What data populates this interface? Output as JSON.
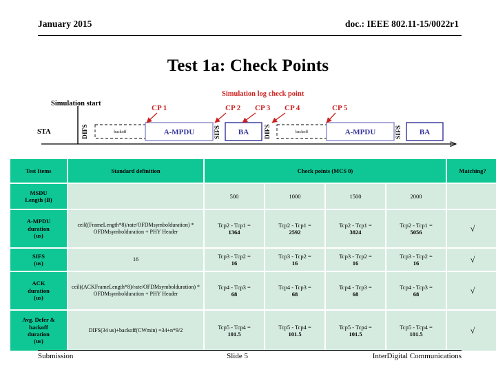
{
  "header": {
    "date": "January 2015",
    "doc": "doc.: IEEE 802.11-15/0022r1"
  },
  "title": "Test 1a: Check Points",
  "diagram": {
    "simulation_start_label": "Simulation start",
    "checkpoint_title": "Simulation log check point",
    "station_label": "STA",
    "checkpoints": [
      "CP 1",
      "CP 2",
      "CP 3",
      "CP 4",
      "CP 5"
    ],
    "frames": [
      {
        "label": "DIFS",
        "style": "vertical"
      },
      {
        "label": "backoff",
        "style": "dashed"
      },
      {
        "label": "A-MPDU",
        "style": "solid"
      },
      {
        "label": "SIFS",
        "style": "vertical"
      },
      {
        "label": "BA",
        "style": "solid"
      },
      {
        "label": "DIFS",
        "style": "vertical"
      },
      {
        "label": "backoff",
        "style": "dashed"
      },
      {
        "label": "A-MPDU",
        "style": "solid"
      },
      {
        "label": "SIFS",
        "style": "vertical"
      },
      {
        "label": "BA",
        "style": "solid"
      }
    ],
    "colors": {
      "checkpoint_red": "#CC2020",
      "frame_blue": "#333399",
      "frame_border": "#8888CC"
    }
  },
  "table": {
    "headers": {
      "test_items": "Test Items",
      "standard_definition": "Standard definition",
      "check_points": "Check points (MCS 0)",
      "matching": "Matching?"
    },
    "rows": [
      {
        "label": "MSDU\nLength (B)",
        "label_line1": "MSDU",
        "label_line2": "Length (B)",
        "definition": "",
        "checkpoints": [
          {
            "expr": "",
            "value": "500"
          },
          {
            "expr": "",
            "value": "1000"
          },
          {
            "expr": "",
            "value": "1500"
          },
          {
            "expr": "",
            "value": "2000"
          }
        ],
        "matching": ""
      },
      {
        "label_line1": "A-MPDU",
        "label_line2": "duration",
        "label_line3": "(us)",
        "definition": "ceil((FrameLength*8)/rate/OFDMsymbolduration) * OFDMsymbolduration + PHY Header",
        "checkpoints": [
          {
            "expr": "Tcp2 - Tcp1 =",
            "value": "1364"
          },
          {
            "expr": "Tcp2 - Tcp1 =",
            "value": "2592"
          },
          {
            "expr": "Tcp2 - Tcp1 =",
            "value": "3824"
          },
          {
            "expr": "Tcp2 - Tcp1 =",
            "value": "5056"
          }
        ],
        "matching": "√"
      },
      {
        "label_line1": "SIFS",
        "label_line2": "(us)",
        "label_line3": "",
        "definition": "16",
        "checkpoints": [
          {
            "expr": "Tcp3 - Tcp2 =",
            "value": "16"
          },
          {
            "expr": "Tcp3 - Tcp2 =",
            "value": "16"
          },
          {
            "expr": "Tcp3 - Tcp2 =",
            "value": "16"
          },
          {
            "expr": "Tcp3 - Tcp2 =",
            "value": "16"
          }
        ],
        "matching": "√"
      },
      {
        "label_line1": "ACK",
        "label_line2": "duration",
        "label_line3": "(us)",
        "definition": "ceil((ACKFrameLength*8)/rate/OFDMsymbolduration) * OFDMsymbolduration + PHY Header",
        "checkpoints": [
          {
            "expr": "Tcp4 - Tcp3 =",
            "value": "68"
          },
          {
            "expr": "Tcp4 - Tcp3 =",
            "value": "68"
          },
          {
            "expr": "Tcp4 - Tcp3 =",
            "value": "68"
          },
          {
            "expr": "Tcp4 - Tcp3 =",
            "value": "68"
          }
        ],
        "matching": "√"
      },
      {
        "label_line1": "Avg. Defer &",
        "label_line2": "backoff",
        "label_line3": "duration",
        "label_line4": "(us)",
        "definition": "DIFS(34 us)+backoff(CWmin) =34+n*9/2",
        "checkpoints": [
          {
            "expr": "Tcp5 - Tcp4 =",
            "value": "101.5"
          },
          {
            "expr": "Tcp5 - Tcp4 =",
            "value": "101.5"
          },
          {
            "expr": "Tcp5 - Tcp4 =",
            "value": "101.5"
          },
          {
            "expr": "Tcp5 - Tcp4 =",
            "value": "101.5"
          }
        ],
        "matching": "√"
      }
    ],
    "colors": {
      "header_green": "#0FC795",
      "cell_green": "#D5EBE0"
    }
  },
  "footer": {
    "left": "Submission",
    "center": "Slide 5",
    "right": "InterDigital Communications"
  }
}
